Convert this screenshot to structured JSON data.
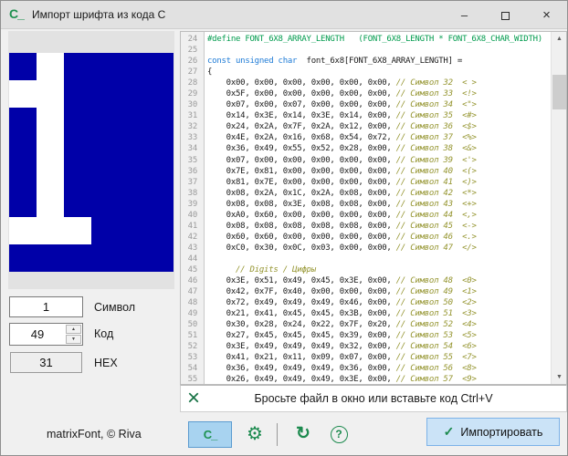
{
  "window": {
    "title": "Импорт шрифта из кода C",
    "app_icon": "C_",
    "minimize_glyph": "–",
    "close_glyph": "×"
  },
  "preview": {
    "off_color": "#0000a8",
    "on_color": "#ffffff",
    "grid": [
      [
        0,
        1,
        0,
        0,
        0,
        0
      ],
      [
        1,
        1,
        0,
        0,
        0,
        0
      ],
      [
        0,
        1,
        0,
        0,
        0,
        0
      ],
      [
        0,
        1,
        0,
        0,
        0,
        0
      ],
      [
        0,
        1,
        0,
        0,
        0,
        0
      ],
      [
        0,
        1,
        0,
        0,
        0,
        0
      ],
      [
        1,
        1,
        1,
        0,
        0,
        0
      ],
      [
        0,
        0,
        0,
        0,
        0,
        0
      ]
    ]
  },
  "fields": {
    "symbol": {
      "value": "1",
      "label": "Символ"
    },
    "code": {
      "value": "49",
      "label": "Код",
      "spin_up": "▲",
      "spin_down": "▼"
    },
    "hex": {
      "value": "31",
      "label": "HEX"
    }
  },
  "editor": {
    "scroll_up": "▲",
    "scroll_down": "▼",
    "lines": [
      {
        "n": "24",
        "parts": [
          [
            "dir",
            "#define FONT_6X8_ARRAY_LENGTH   (FONT_6X8_LENGTH * FONT_6X8_CHAR_WIDTH)"
          ]
        ]
      },
      {
        "n": "25",
        "parts": []
      },
      {
        "n": "26",
        "parts": [
          [
            "kw",
            "const unsigned char"
          ],
          [
            "pl",
            "  font_6x8[FONT_6X8_ARRAY_LENGTH] ="
          ]
        ]
      },
      {
        "n": "27",
        "parts": [
          [
            "pl",
            "{"
          ]
        ]
      },
      {
        "n": "28",
        "parts": [
          [
            "pl",
            "    0x00, 0x00, 0x00, 0x00, 0x00, 0x00, "
          ],
          [
            "cm",
            "// Символ 32  < >"
          ]
        ]
      },
      {
        "n": "29",
        "parts": [
          [
            "pl",
            "    0x5F, 0x00, 0x00, 0x00, 0x00, 0x00, "
          ],
          [
            "cm",
            "// Символ 33  <!>"
          ]
        ]
      },
      {
        "n": "30",
        "parts": [
          [
            "pl",
            "    0x07, 0x00, 0x07, 0x00, 0x00, 0x00, "
          ],
          [
            "cm",
            "// Символ 34  <\">"
          ]
        ]
      },
      {
        "n": "31",
        "parts": [
          [
            "pl",
            "    0x14, 0x3E, 0x14, 0x3E, 0x14, 0x00, "
          ],
          [
            "cm",
            "// Символ 35  <#>"
          ]
        ]
      },
      {
        "n": "32",
        "parts": [
          [
            "pl",
            "    0x24, 0x2A, 0x7F, 0x2A, 0x12, 0x00, "
          ],
          [
            "cm",
            "// Символ 36  <$>"
          ]
        ]
      },
      {
        "n": "33",
        "parts": [
          [
            "pl",
            "    0x4E, 0x2A, 0x16, 0x68, 0x54, 0x72, "
          ],
          [
            "cm",
            "// Символ 37  <%>"
          ]
        ]
      },
      {
        "n": "34",
        "parts": [
          [
            "pl",
            "    0x36, 0x49, 0x55, 0x52, 0x28, 0x00, "
          ],
          [
            "cm",
            "// Символ 38  <&>"
          ]
        ]
      },
      {
        "n": "35",
        "parts": [
          [
            "pl",
            "    0x07, 0x00, 0x00, 0x00, 0x00, 0x00, "
          ],
          [
            "cm",
            "// Символ 39  <'>"
          ]
        ]
      },
      {
        "n": "36",
        "parts": [
          [
            "pl",
            "    0x7E, 0x81, 0x00, 0x00, 0x00, 0x00, "
          ],
          [
            "cm",
            "// Символ 40  <(>"
          ]
        ]
      },
      {
        "n": "37",
        "parts": [
          [
            "pl",
            "    0x81, 0x7E, 0x00, 0x00, 0x00, 0x00, "
          ],
          [
            "cm",
            "// Символ 41  <)>"
          ]
        ]
      },
      {
        "n": "38",
        "parts": [
          [
            "pl",
            "    0x08, 0x2A, 0x1C, 0x2A, 0x08, 0x00, "
          ],
          [
            "cm",
            "// Символ 42  <*>"
          ]
        ]
      },
      {
        "n": "39",
        "parts": [
          [
            "pl",
            "    0x08, 0x08, 0x3E, 0x08, 0x08, 0x00, "
          ],
          [
            "cm",
            "// Символ 43  <+>"
          ]
        ]
      },
      {
        "n": "40",
        "parts": [
          [
            "pl",
            "    0xA0, 0x60, 0x00, 0x00, 0x00, 0x00, "
          ],
          [
            "cm",
            "// Символ 44  <,>"
          ]
        ]
      },
      {
        "n": "41",
        "parts": [
          [
            "pl",
            "    0x08, 0x08, 0x08, 0x08, 0x08, 0x00, "
          ],
          [
            "cm",
            "// Символ 45  <->"
          ]
        ]
      },
      {
        "n": "42",
        "parts": [
          [
            "pl",
            "    0x60, 0x60, 0x00, 0x00, 0x00, 0x00, "
          ],
          [
            "cm",
            "// Символ 46  <.>"
          ]
        ]
      },
      {
        "n": "43",
        "parts": [
          [
            "pl",
            "    0xC0, 0x30, 0x0C, 0x03, 0x00, 0x00, "
          ],
          [
            "cm",
            "// Символ 47  </>"
          ]
        ]
      },
      {
        "n": "44",
        "parts": []
      },
      {
        "n": "45",
        "parts": [
          [
            "pl",
            "      "
          ],
          [
            "cm",
            "// Digits / Цифры"
          ]
        ]
      },
      {
        "n": "46",
        "parts": [
          [
            "pl",
            "    0x3E, 0x51, 0x49, 0x45, 0x3E, 0x00, "
          ],
          [
            "cm",
            "// Символ 48  <0>"
          ]
        ]
      },
      {
        "n": "47",
        "parts": [
          [
            "pl",
            "    0x42, 0x7F, 0x40, 0x00, 0x00, 0x00, "
          ],
          [
            "cm",
            "// Символ 49  <1>"
          ]
        ]
      },
      {
        "n": "48",
        "parts": [
          [
            "pl",
            "    0x72, 0x49, 0x49, 0x49, 0x46, 0x00, "
          ],
          [
            "cm",
            "// Символ 50  <2>"
          ]
        ]
      },
      {
        "n": "49",
        "parts": [
          [
            "pl",
            "    0x21, 0x41, 0x45, 0x45, 0x3B, 0x00, "
          ],
          [
            "cm",
            "// Символ 51  <3>"
          ]
        ]
      },
      {
        "n": "50",
        "parts": [
          [
            "pl",
            "    0x30, 0x28, 0x24, 0x22, 0x7F, 0x20, "
          ],
          [
            "cm",
            "// Символ 52  <4>"
          ]
        ]
      },
      {
        "n": "51",
        "parts": [
          [
            "pl",
            "    0x27, 0x45, 0x45, 0x45, 0x39, 0x00, "
          ],
          [
            "cm",
            "// Символ 53  <5>"
          ]
        ]
      },
      {
        "n": "52",
        "parts": [
          [
            "pl",
            "    0x3E, 0x49, 0x49, 0x49, 0x32, 0x00, "
          ],
          [
            "cm",
            "// Символ 54  <6>"
          ]
        ]
      },
      {
        "n": "53",
        "parts": [
          [
            "pl",
            "    0x41, 0x21, 0x11, 0x09, 0x07, 0x00, "
          ],
          [
            "cm",
            "// Символ 55  <7>"
          ]
        ]
      },
      {
        "n": "54",
        "parts": [
          [
            "pl",
            "    0x36, 0x49, 0x49, 0x49, 0x36, 0x00, "
          ],
          [
            "cm",
            "// Символ 56  <8>"
          ]
        ]
      },
      {
        "n": "55",
        "parts": [
          [
            "pl",
            "    0x26, 0x49, 0x49, 0x49, 0x3E, 0x00, "
          ],
          [
            "cm",
            "// Символ 57  <9>"
          ]
        ]
      }
    ]
  },
  "dropzone": {
    "clear_icon": "×",
    "hint": "Бросьте файл в окно или вставьте код Ctrl+V"
  },
  "footer": {
    "credit": "matrixFont, © Riva",
    "c_code_button": "C_",
    "gear_icon": "⚙",
    "refresh_icon": "↻",
    "help_icon": "?",
    "import_check": "✓",
    "import_label": "Импортировать"
  },
  "colors": {
    "accent_green": "#1c8a4e",
    "button_blue_bg": "#cbe3f7",
    "pixel_blue": "#0000a8",
    "comment_olive": "#94942e",
    "keyword_blue": "#1c7ad6",
    "directive_green": "#009b4d"
  }
}
